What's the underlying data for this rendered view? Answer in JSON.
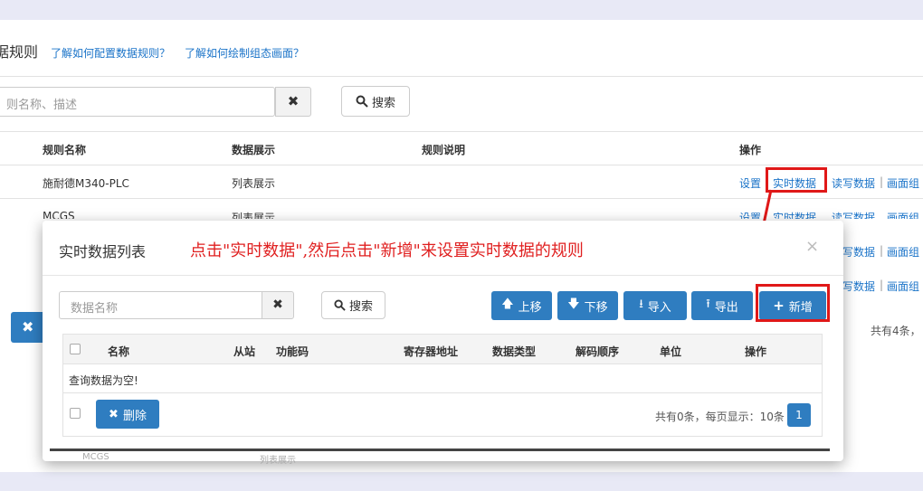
{
  "background": {
    "title": "据规则",
    "help_links": [
      "了解如何配置数据规则？",
      "了解如何绘制组态画面？"
    ],
    "search_placeholder": "则名称、描述",
    "clear_icon": "✖",
    "search_button": "搜索",
    "table_headers": [
      "规则名称",
      "数据展示",
      "规则说明",
      "操作"
    ],
    "rows": [
      {
        "name": "施耐德M340-PLC",
        "display": "列表展示"
      },
      {
        "name": "MCGS",
        "display": "列表展示"
      }
    ],
    "ops": {
      "settings": "设置",
      "realtime": "实时数据",
      "readwrite": "读写数据",
      "screen": "画面组"
    },
    "total_text": "共有4条，",
    "ghost_row_name": "MCGS",
    "ghost_row_display": "列表展示"
  },
  "modal": {
    "title": "实时数据列表",
    "annotation": "点击\"实时数据\",然后点击\"新增\"来设置实时数据的规则",
    "close_icon": "×",
    "search_placeholder": "数据名称",
    "clear_icon": "✖",
    "search_button": "搜索",
    "buttons": {
      "up": "上移",
      "down": "下移",
      "import": "导入",
      "export": "导出",
      "add": "新增"
    },
    "columns": [
      "名称",
      "从站",
      "功能码",
      "寄存器地址",
      "数据类型",
      "解码顺序",
      "单位",
      "操作"
    ],
    "empty_text": "查询数据为空!",
    "delete_button": "删除",
    "total_text": "共有0条，每页显示：10条",
    "page_number": "1"
  },
  "colors": {
    "primary": "#2f7dc0",
    "link": "#1a73c8",
    "annotation_red": "#e01818"
  }
}
